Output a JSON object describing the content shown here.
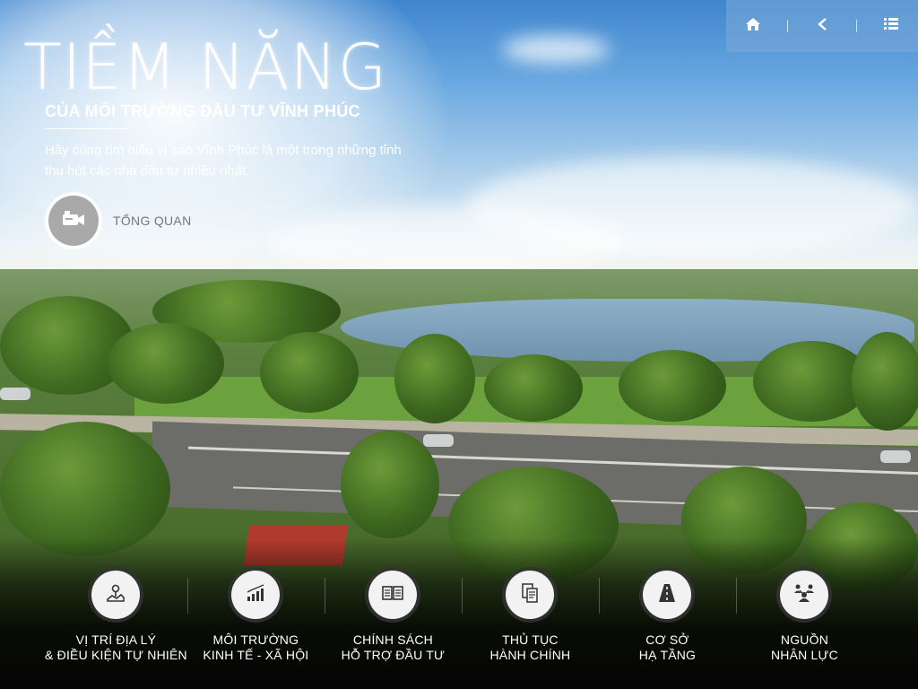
{
  "header": {
    "title": "TIỀM NĂNG",
    "subtitle": "CỦA MÔI TRƯỜNG ĐẦU TƯ VĨNH PHÚC",
    "intro_line1": "Hãy cùng tìm hiểu vì sao Vĩnh Phúc là một trong những tỉnh",
    "intro_line2": "thu hút các nhà đầu tư nhiều nhất."
  },
  "overview": {
    "label": "TỔNG QUAN",
    "icon": "video-camera-icon"
  },
  "toolbar": {
    "icons": [
      "home-icon",
      "back-icon",
      "list-icon"
    ]
  },
  "nav": [
    {
      "line1": "VỊ TRÍ ĐỊA LÝ",
      "line2": "& ĐIỀU KIỆN TỰ NHIÊN",
      "icon": "map-pin-icon"
    },
    {
      "line1": "MÔI TRƯỜNG",
      "line2": "KINH TẾ - XÃ HỘI",
      "icon": "bar-chart-icon"
    },
    {
      "line1": "CHÍNH SÁCH",
      "line2": "HỖ TRỢ ĐẦU TƯ",
      "icon": "open-book-icon"
    },
    {
      "line1": "THỦ TỤC",
      "line2": "HÀNH CHÍNH",
      "icon": "documents-icon"
    },
    {
      "line1": "CƠ SỞ",
      "line2": "HẠ TẦNG",
      "icon": "road-icon"
    },
    {
      "line1": "NGUỒN",
      "line2": "NHÂN LỰC",
      "icon": "people-icon"
    }
  ],
  "colors": {
    "icon_dark": "#333333",
    "nav_circle": "#f2f2f2",
    "overview_circle": "#a9a9a9"
  }
}
